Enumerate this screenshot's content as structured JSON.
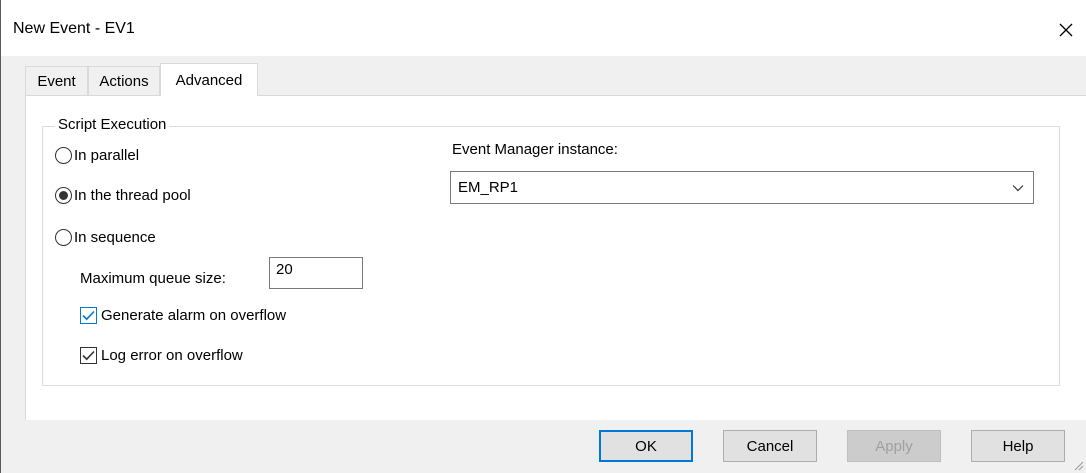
{
  "window": {
    "title": "New Event - EV1",
    "close_glyph": "✕"
  },
  "tabs": [
    {
      "label": "Event",
      "active": false
    },
    {
      "label": "Actions",
      "active": false
    },
    {
      "label": "Advanced",
      "active": true
    }
  ],
  "script_execution": {
    "legend": "Script Execution",
    "options": [
      {
        "label": "In parallel",
        "selected": false
      },
      {
        "label": "In the thread pool",
        "selected": true
      },
      {
        "label": "In sequence",
        "selected": false
      }
    ],
    "max_queue_label": "Maximum queue size:",
    "max_queue_value": "20",
    "generate_alarm_label": "Generate alarm on overflow",
    "generate_alarm_checked": true,
    "log_error_label": "Log error on overflow",
    "log_error_checked": true
  },
  "event_manager": {
    "label": "Event Manager instance:",
    "selected": "EM_RP1"
  },
  "buttons": {
    "ok": "OK",
    "cancel": "Cancel",
    "apply": "Apply",
    "help": "Help"
  },
  "colors": {
    "accent": "#0078d7",
    "dialog_bg": "#f0f0f0",
    "panel_bg": "#ffffff",
    "disabled_text": "#a0a0a0"
  },
  "icons": [
    "close-icon",
    "chevron-down-icon",
    "checkmark-icon",
    "resize-grip-icon"
  ]
}
